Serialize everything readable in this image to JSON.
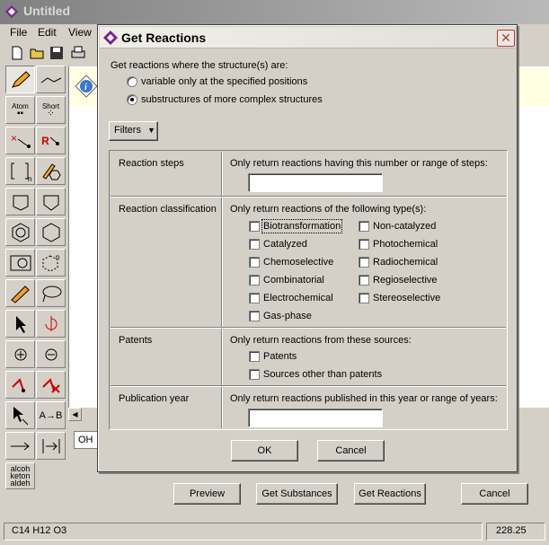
{
  "main_window": {
    "title": "Untitled",
    "menu": [
      "File",
      "Edit",
      "View"
    ],
    "palette": {
      "atom_label": "Atom",
      "short_label": "Short",
      "reaction_label": "R",
      "arrow_label": "A→B",
      "name_text": "alcoh keton aldeh"
    },
    "formula_field_value": "OH",
    "buttons": {
      "preview": "Preview",
      "get_substances": "Get Substances",
      "get_reactions": "Get Reactions",
      "cancel": "Cancel"
    },
    "status": {
      "formula": "C14 H12 O3",
      "weight": "228.25"
    }
  },
  "dialog": {
    "title": "Get Reactions",
    "prompt": "Get reactions where the structure(s) are:",
    "radio_options": [
      {
        "label": "variable only at the specified positions",
        "checked": false
      },
      {
        "label": "substructures of more complex structures",
        "checked": true
      }
    ],
    "filters_label": "Filters",
    "sections": {
      "steps": {
        "label": "Reaction steps",
        "text": "Only return reactions having this number or range of steps:",
        "value": ""
      },
      "classification": {
        "label": "Reaction classification",
        "text": "Only return reactions of the following type(s):",
        "types_left": [
          "Biotransformation",
          "Catalyzed",
          "Chemoselective",
          "Combinatorial",
          "Electrochemical",
          "Gas-phase"
        ],
        "types_right": [
          "Non-catalyzed",
          "Photochemical",
          "Radiochemical",
          "Regioselective",
          "Stereoselective"
        ]
      },
      "patents": {
        "label": "Patents",
        "text": "Only return reactions from these sources:",
        "options": [
          "Patents",
          "Sources other than patents"
        ]
      },
      "year": {
        "label": "Publication year",
        "text": "Only return reactions published in this year or range of years:",
        "value": ""
      }
    },
    "ok_label": "OK",
    "cancel_label": "Cancel"
  }
}
